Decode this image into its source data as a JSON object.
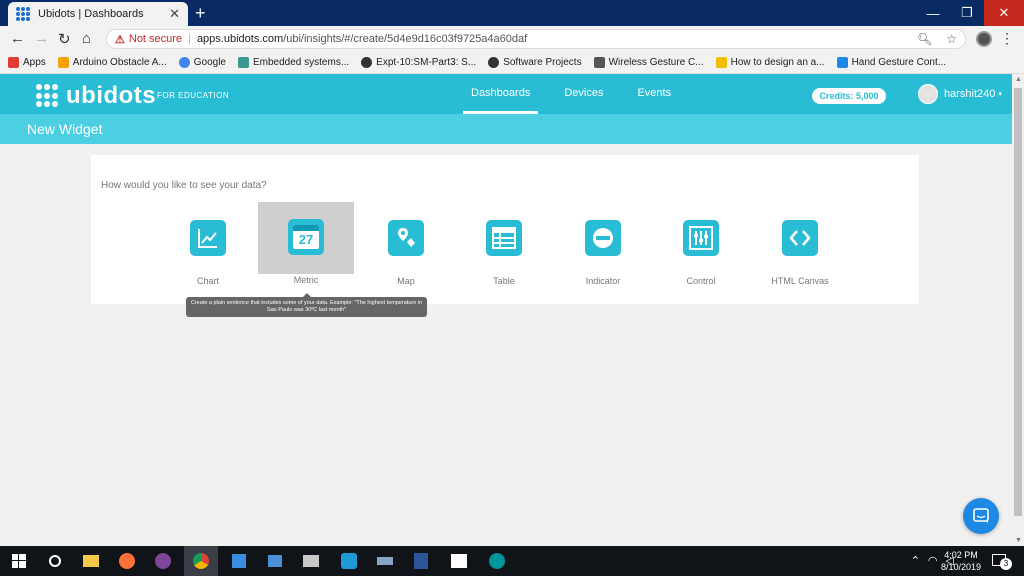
{
  "browser": {
    "tab_title": "Ubidots | Dashboards",
    "tab_close": "✕",
    "new_tab": "+",
    "security_label": "Not secure",
    "url_host": "apps.ubidots.com",
    "url_path": "/ubi/insights/#/create/5d4e9d16c03f9725a4a60daf",
    "window_buttons": [
      "—",
      "❐",
      "✕"
    ]
  },
  "bookmarks": [
    {
      "label": "Apps",
      "color": "#e53935"
    },
    {
      "label": "Arduino Obstacle A...",
      "color": "#f4a300"
    },
    {
      "label": "Google",
      "color": "#4285f4"
    },
    {
      "label": "Embedded systems...",
      "color": "#3b9a8f"
    },
    {
      "label": "Expt-10:SM-Part3: S...",
      "color": "#333333"
    },
    {
      "label": "Software Projects",
      "color": "#333333"
    },
    {
      "label": "Wireless Gesture C...",
      "color": "#555555"
    },
    {
      "label": "How to design an a...",
      "color": "#f0c000"
    },
    {
      "label": "Hand Gesture Cont...",
      "color": "#1e88e5"
    }
  ],
  "app": {
    "logo_text": "ubidots",
    "edition": "FOR EDUCATION",
    "nav": [
      "Dashboards",
      "Devices",
      "Events"
    ],
    "credits": "Credits: 5,000",
    "username": "harshit240",
    "page_title": "New Widget",
    "question": "How would you like to see your data?",
    "calendar_day": "27",
    "widgets": [
      {
        "label": "Chart",
        "icon": "line-chart-icon"
      },
      {
        "label": "Metric",
        "icon": "calendar-icon"
      },
      {
        "label": "Map",
        "icon": "map-pin-icon"
      },
      {
        "label": "Table",
        "icon": "table-icon"
      },
      {
        "label": "Indicator",
        "icon": "indicator-icon"
      },
      {
        "label": "Control",
        "icon": "sliders-icon"
      },
      {
        "label": "HTML Canvas",
        "icon": "code-icon"
      }
    ],
    "tooltip": "Create a plain sentence that includes some of your data. Example: \"The highest temperature in Sao Paulo was 30ºC last month\"",
    "accent_color": "#28bdd5"
  },
  "taskbar": {
    "time": "4:02 PM",
    "date": "8/10/2019",
    "notification_count": "3"
  }
}
